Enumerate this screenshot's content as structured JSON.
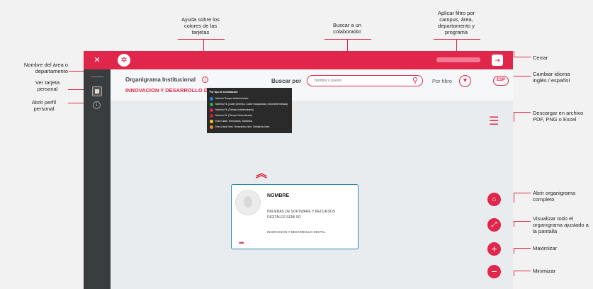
{
  "annotations": {
    "ayuda": "Ayuda sobre los colores de las tarjetas",
    "buscar": "Buscar a un colaborador",
    "filtro": "Aplicar filtro por campus, área, departamento y programa",
    "nombre_area": "Nombre del área o departamento",
    "ver_tarjeta": "Ver tarjeta personal",
    "abrir_perfil": "Abrir perfil personal",
    "cerrar": "Cerrar",
    "idioma": "Cambiar idioma inglés / español",
    "descargar": "Descargar en archivo PDF, PNG o Excel",
    "abrir_org": "Abrir organigrama completo",
    "visualizar": "Visualizar todo el organigrama ajustado a la pantalla",
    "maximizar": "Maximizar",
    "minimizar": "Minimizar"
  },
  "app": {
    "title": "Organigrama Institucional",
    "area": "INNOVACION Y DESARROLLO DIGITAL",
    "search_label": "Buscar por",
    "search_placeholder": "Nombre o puesto",
    "filter_label": "Por filtro",
    "language": "ESP",
    "close_glyph": "×"
  },
  "legend": {
    "title": "Por tipo de contratación:",
    "items": [
      {
        "label": "Nómina Tiempo Indeterminado",
        "color": "#2a84d8"
      },
      {
        "label": "Nómina Fil. (Cubre permiso, Cubre Incapacidad, Obra determinada)",
        "color": "#2eb04e"
      },
      {
        "label": "Nómina Fil. (Tiempo Indeterminado)",
        "color": "#e0264a"
      },
      {
        "label": "Nómina Fil. (Tiempo Determinado)",
        "color": "#d01e3a"
      },
      {
        "label": "Hora Clase, Honorarios, Solidarios",
        "color": "#f5c518"
      },
      {
        "label": "Hora clase-Nom, Honorarios-Nom, Solidarios-Nom",
        "color": "#f08a1c"
      }
    ]
  },
  "card": {
    "name": "NOMBRE",
    "position": "PRUEBAS DE SOFTWARE Y RECURSOS DIGITALES SEMI SR",
    "area": "INNOVACION Y DESARROLLO DIGITAL",
    "more": "•••"
  },
  "colors": {
    "accent": "#e0264a",
    "sidebar": "#3a3d40",
    "card_border": "#2a84b0"
  }
}
